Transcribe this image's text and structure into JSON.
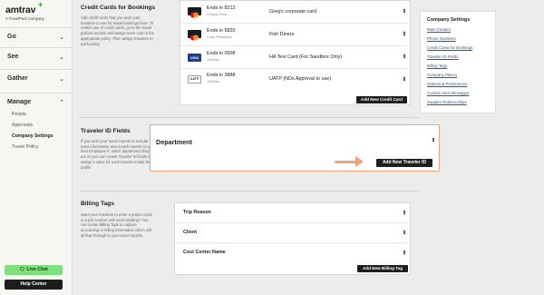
{
  "brand": {
    "name": "amtrav",
    "plus": "+",
    "tagline": "A TravelPerk Company"
  },
  "nav": {
    "sections": [
      {
        "label": "Go",
        "chevron": "⌄"
      },
      {
        "label": "See",
        "chevron": "⌄"
      },
      {
        "label": "Gather",
        "chevron": "⌄"
      },
      {
        "label": "Manage",
        "chevron": "⌃"
      }
    ],
    "manage_items": [
      "People",
      "Approvals",
      "Company Settings",
      "Travel Policy"
    ],
    "live_chat": "Live Chat",
    "help_center": "Help Center"
  },
  "credit_cards": {
    "title": "Credit Cards for Bookings",
    "desc": "Add credit cards that you want your travelers to use for travel bookings here. To restrict use of credit cards, go to the travel policies section and assign each card to the appropriate policy. Then assign travelers to each policy.",
    "cards": [
      {
        "number": "Ends in 8212",
        "holder": "Gregory Kreis",
        "name": "Greg's corporate card",
        "brand": "mastercard"
      },
      {
        "number": "Ends in 5820",
        "holder": "Craig Fichtelberg",
        "name": "Fish Diners",
        "brand": "mastercard"
      },
      {
        "number": "Ends in 0008",
        "holder": "Jeff Kaw",
        "name": "HA Test Card (For Sandbox Only)",
        "brand": "visa",
        "brand_label": "VISA"
      },
      {
        "number": "Ends in 3888",
        "holder": "Jeff Kaw",
        "name": "UATP (NDs Approval to use)",
        "brand": "uatp",
        "brand_label": "UATP"
      }
    ],
    "add_button": "Add New Credit Card"
  },
  "traveler_ids": {
    "title": "Traveler ID Fields",
    "desc": "If you want your travel reports to include extra information about each traveler (e.g. their Employee #, which department they are in) you can create Traveler ID fields and assign a value for each traveler inside their profile.",
    "field": "Department",
    "add_button": "Add New Traveler ID"
  },
  "billing_tags": {
    "title": "Billing Tags",
    "desc": "Want your travelers to enter a project code or a job number with each booking? You can create Billing Tags to capture accounting or billing information which will all flow through to your travel reports.",
    "tags": [
      "Trip Reason",
      "Client",
      "Cost Center Name"
    ],
    "add_button": "Add New Billing Tag"
  },
  "company_settings_panel": {
    "title": "Company Settings",
    "links": [
      "Main Contact",
      "Phone Numbers",
      "Credit Cards for Bookings",
      "Traveler ID Fields",
      "Billing Tags",
      "Company Places",
      "Options & Preferences",
      "Custom Alert Messages",
      "Supplier Relationships"
    ]
  },
  "colors": {
    "accent_green": "#7ee07a",
    "highlight_border": "#f3a37a",
    "arrow": "#f0a27e",
    "link": "#2b5a8f"
  }
}
